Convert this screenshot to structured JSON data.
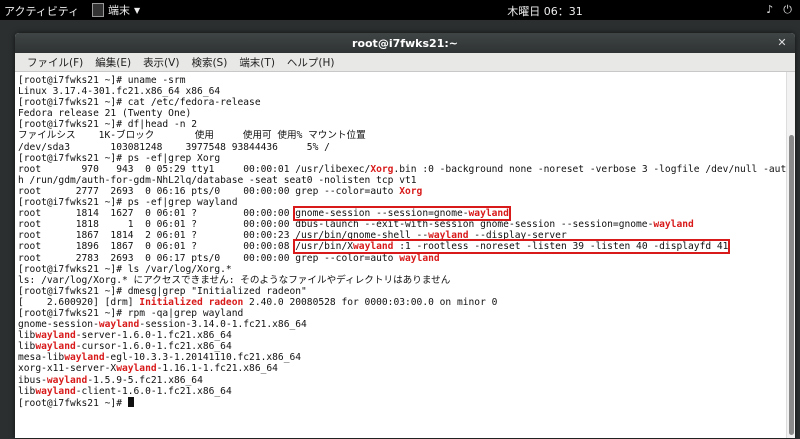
{
  "topbar": {
    "activities": "アクティビティ",
    "app_name": "端末",
    "clock": "木曜日 06：31"
  },
  "window": {
    "title": "root@i7fwks21:~",
    "menu": [
      "ファイル(F)",
      "編集(E)",
      "表示(V)",
      "検索(S)",
      "端末(T)",
      "ヘルプ(H)"
    ]
  },
  "terminal": {
    "l1": "[root@i7fwks21 ~]# uname -srm",
    "l2": "Linux 3.17.4-301.fc21.x86_64 x86_64",
    "l3": "[root@i7fwks21 ~]# cat /etc/fedora-release",
    "l4": "Fedora release 21 (Twenty One)",
    "l5": "[root@i7fwks21 ~]# df|head -n 2",
    "l6": "ファイルシス    1K-ブロック       使用     使用可 使用% マウント位置",
    "l7": "/dev/sda3       103081248    3977548 93844436     5% /",
    "l8": "[root@i7fwks21 ~]# ps -ef|grep Xorg",
    "l9a": "root       970   943  0 05:29 tty1     00:00:01 /usr/libexec/",
    "l9b": "Xorg",
    "l9c": ".bin :0 -background none -noreset -verbose 3 -logfile /dev/null -aut",
    "l10": "h /run/gdm/auth-for-gdm-NhL2lq/database -seat seat0 -nolisten tcp vt1",
    "l11a": "root      2777  2693  0 06:16 pts/0    00:00:00 grep --color=auto ",
    "l11b": "Xorg",
    "l12": "[root@i7fwks21 ~]# ps -ef|grep wayland",
    "l13a": "root      1814  1627  0 06:01 ?        00:00:00 ",
    "l13b": "gnome-session --session=gnome-",
    "l13c": "wayland",
    "l14a": "root      1818     1  0 06:01 ?        00:00:00 dbus-launch --exit-with-session gnome-session --session=gnome-",
    "l14b": "wayland",
    "l15a": "root      1867  1814  2 06:01 ?        00:00:23 /usr/bin/gnome-shell --",
    "l15b": "wayland",
    "l15c": " --display-server",
    "l16a": "root      1896  1867  0 06:01 ?        00:00:08 ",
    "l16b": "/usr/bin/X",
    "l16c": "wayland",
    "l16d": " :1 -rootless -noreset -listen 39 -listen 40 -displayfd 41",
    "l17a": "root      2783  2693  0 06:17 pts/0    00:00:00 grep --color=auto ",
    "l17b": "wayland",
    "l18": "[root@i7fwks21 ~]# ls /var/log/Xorg.*",
    "l19": "ls: /var/log/Xorg.* にアクセスできません: そのようなファイルやディレクトリはありません",
    "l20": "[root@i7fwks21 ~]# dmesg|grep \"Initialized radeon\"",
    "l21a": "[    2.600920] [drm] ",
    "l21b": "Initialized radeon",
    "l21c": " 2.40.0 20080528 for 0000:03:00.0 on minor 0",
    "l22": "[root@i7fwks21 ~]# rpm -qa|grep wayland",
    "l23a": "gnome-session-",
    "l23b": "wayland",
    "l23c": "-session-3.14.0-1.fc21.x86_64",
    "l24a": "lib",
    "l24b": "wayland",
    "l24c": "-server-1.6.0-1.fc21.x86_64",
    "l25a": "lib",
    "l25b": "wayland",
    "l25c": "-cursor-1.6.0-1.fc21.x86_64",
    "l26a": "mesa-lib",
    "l26b": "wayland",
    "l26c": "-egl-10.3.3-1.20141110.fc21.x86_64",
    "l27a": "xorg-x11-server-X",
    "l27b": "wayland",
    "l27c": "-1.16.1-1.fc21.x86_64",
    "l28a": "ibus-",
    "l28b": "wayland",
    "l28c": "-1.5.9-5.fc21.x86_64",
    "l29a": "lib",
    "l29b": "wayland",
    "l29c": "-client-1.6.0-1.fc21.x86_64",
    "l30": "[root@i7fwks21 ~]# "
  },
  "colors": {
    "highlight": "#d81a1a",
    "panel": "#000000"
  }
}
